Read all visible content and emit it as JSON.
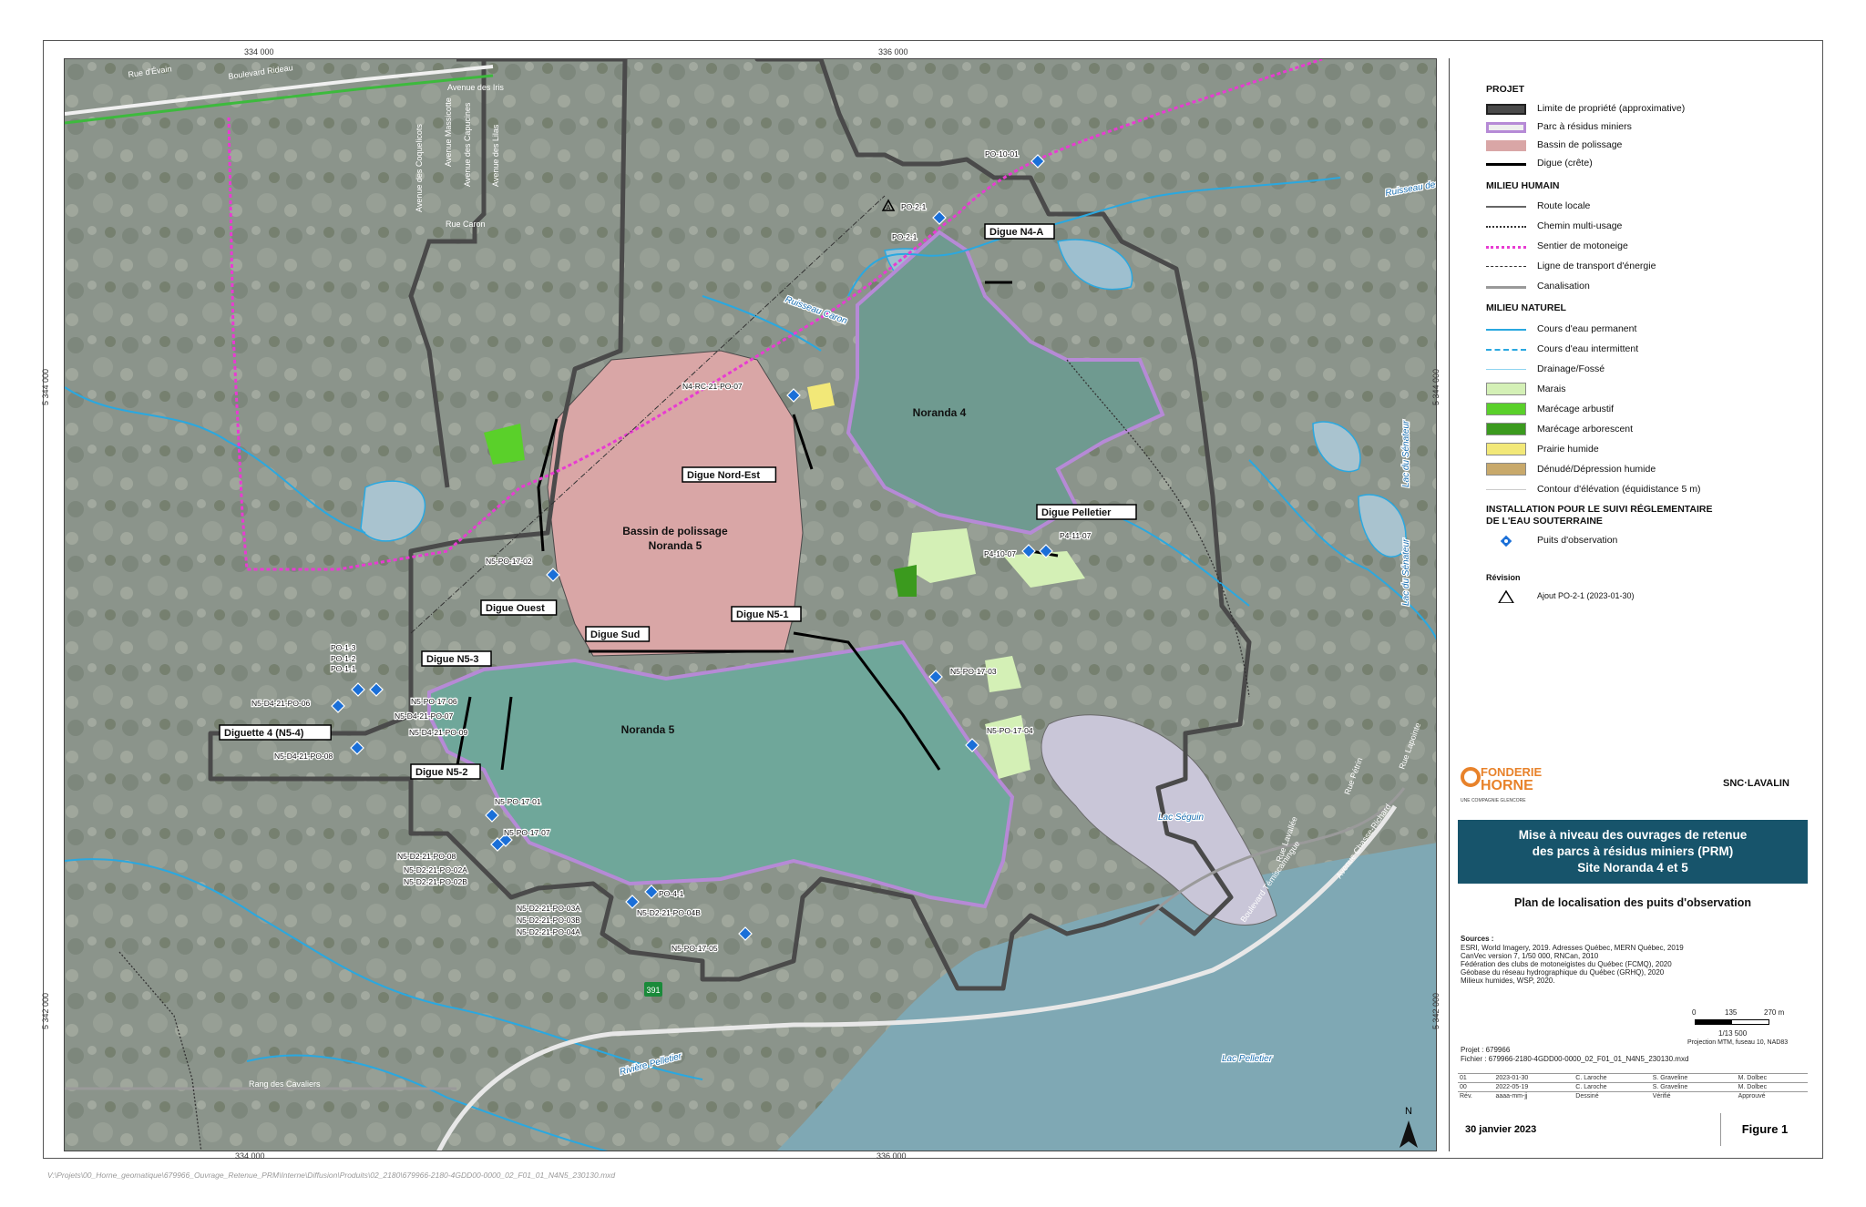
{
  "coords": {
    "top_x": [
      "334 000",
      "336 000"
    ],
    "bottom_x": [
      "334 000",
      "336 000"
    ],
    "left_y": [
      "5 344 000",
      "5 342 000"
    ],
    "right_y": [
      "5 344 000",
      "5 342 000"
    ]
  },
  "map_labels": {
    "streets": [
      "Rue d'Évain",
      "Boulevard Rideau",
      "Avenue des Iris",
      "Avenue des Coquelicots",
      "Avenue Massicotte",
      "Avenue des Capucines",
      "Avenue des Lilas",
      "Rue Caron",
      "Rang des Cavaliers",
      "Boulevard Témiscamingue",
      "Avenue Chasse-Richard",
      "Rue Lavallée",
      "Rue Pétrin",
      "Rue Lapointe"
    ],
    "water": [
      "Ruisseau Caron",
      "Ruisseau des Résidus",
      "Lac du Sénateur",
      "Lac du Sénateur",
      "Lac Séguin",
      "Lac Pelletier",
      "Rivière Pelletier"
    ],
    "areas": [
      "Noranda 4",
      "Noranda 5",
      "Bassin de polissage",
      "Noranda 5"
    ],
    "dikes": [
      "Digue N4-A",
      "Digue Nord-Est",
      "Digue Pelletier",
      "Digue Ouest",
      "Digue Sud",
      "Digue N5-1",
      "Digue N5-3",
      "Diguette 4 (N5-4)",
      "Digue N5-2"
    ],
    "wells": [
      "PO-10-01",
      "PO-2-1",
      "PO-2-1",
      "N4-RC-21-PO-07",
      "N5-PO-17-02",
      "P4-10-07",
      "P4-11-07",
      "N5-PO-17-03",
      "N5-PO-17-04",
      "PO-1-3",
      "PO-1-2",
      "PO-1-1",
      "N5-D4-21-PO-06",
      "N5-PO-17-06",
      "N5-D4-21-PO-07",
      "N5-D4-21-PO-09",
      "N5-D4-21-PO-08",
      "N5-PO-17-01",
      "N5-PO-17-07",
      "N5-D2-21-PO-08",
      "N5-D2-21-PO-02A",
      "N5-D2-21-PO-02B",
      "PO-4-1",
      "N5-D2-21-PO-04B",
      "N5-D2-21-PO-03A",
      "N5-D2-21-PO-03B",
      "N5-D2-21-PO-04A",
      "N5-PO-17-05"
    ],
    "route": "391",
    "north": "N",
    "revision_mark": "A"
  },
  "legend": {
    "projet_title": "PROJET",
    "projet": [
      "Limite de propriété (approximative)",
      "Parc à résidus miniers",
      "Bassin de polissage",
      "Digue (crête)"
    ],
    "humain_title": "MILIEU HUMAIN",
    "humain": [
      "Route locale",
      "Chemin multi-usage",
      "Sentier de motoneige",
      "Ligne de transport d'énergie",
      "Canalisation"
    ],
    "naturel_title": "MILIEU NATUREL",
    "naturel": [
      "Cours d'eau permanent",
      "Cours d'eau intermittent",
      "Drainage/Fossé",
      "Marais",
      "Marécage arbustif",
      "Marécage arborescent",
      "Prairie humide",
      "Dénudé/Dépression humide",
      "Contour d'élévation (équidistance 5 m)"
    ],
    "install_title_1": "INSTALLATION POUR LE SUIVI RÉGLEMENTAIRE",
    "install_title_2": "DE L'EAU SOUTERRAINE",
    "install": [
      "Puits d'observation"
    ],
    "revision_title": "Révision",
    "revision_mark": "A",
    "revision": "Ajout  PO-2-1 (2023-01-30)"
  },
  "colors": {
    "property": "#4a4a4a",
    "tailings": "#b68ad6",
    "basin": "#d9a6a6",
    "marais": "#d4f0b6",
    "arbustif": "#5ad02a",
    "arborescent": "#3b9a1e",
    "prairie": "#f2e878",
    "denude": "#c8a96b",
    "water": "#2aa8e0",
    "snowmobile": "#e83bd2",
    "title_bg": "#17546b"
  },
  "logos": {
    "client_line1": "FONDERIE",
    "client_line2": "HORNE",
    "client_sub": "UNE COMPAGNIE GLENCORE",
    "engineer": "SNC·LAVALIN"
  },
  "title": {
    "line1": "Mise à niveau des ouvrages de retenue",
    "line2": "des parcs à résidus miniers (PRM)",
    "line3": "Site Noranda 4 et 5",
    "subtitle": "Plan de localisation des puits d'observation"
  },
  "sources": {
    "heading": "Sources :",
    "lines": [
      "ESRI, World Imagery, 2019. Adresses Québec, MERN Québec, 2019",
      "CanVec version 7, 1/50 000, RNCan, 2010",
      "Fédération des clubs de motoneigistes du Québec (FCMQ), 2020",
      "Géobase du réseau hydrographique du Québec (GRHQ), 2020",
      "Milieux humides, WSP, 2020."
    ]
  },
  "scale": {
    "ticks": [
      "0",
      "135",
      "270 m"
    ],
    "ratio": "1/13 500",
    "projection": "Projection MTM, fuseau 10, NAD83"
  },
  "project": {
    "number": "Projet : 679966",
    "file": "Fichier : 679966-2180-4GDD00-0000_02_F01_01_N4N5_230130.mxd"
  },
  "revisions": [
    [
      "01",
      "2023-01-30",
      "C. Laroche",
      "S. Graveline",
      "M. Dolbec"
    ],
    [
      "00",
      "2022-05-19",
      "C. Laroche",
      "S. Graveline",
      "M. Dolbec"
    ],
    [
      "Rév.",
      "aaaa-mm-jj",
      "Dessiné",
      "Vérifié",
      "Approuvé"
    ]
  ],
  "date": "30 janvier 2023",
  "figure": "Figure 1",
  "filepath": "V:\\Projets\\00_Horne_geomatique\\679966_Ouvrage_Retenue_PRM\\Interne\\Diffusion\\Produits\\02_2180\\679966-2180-4GDD00-0000_02_F01_01_N4N5_230130.mxd"
}
